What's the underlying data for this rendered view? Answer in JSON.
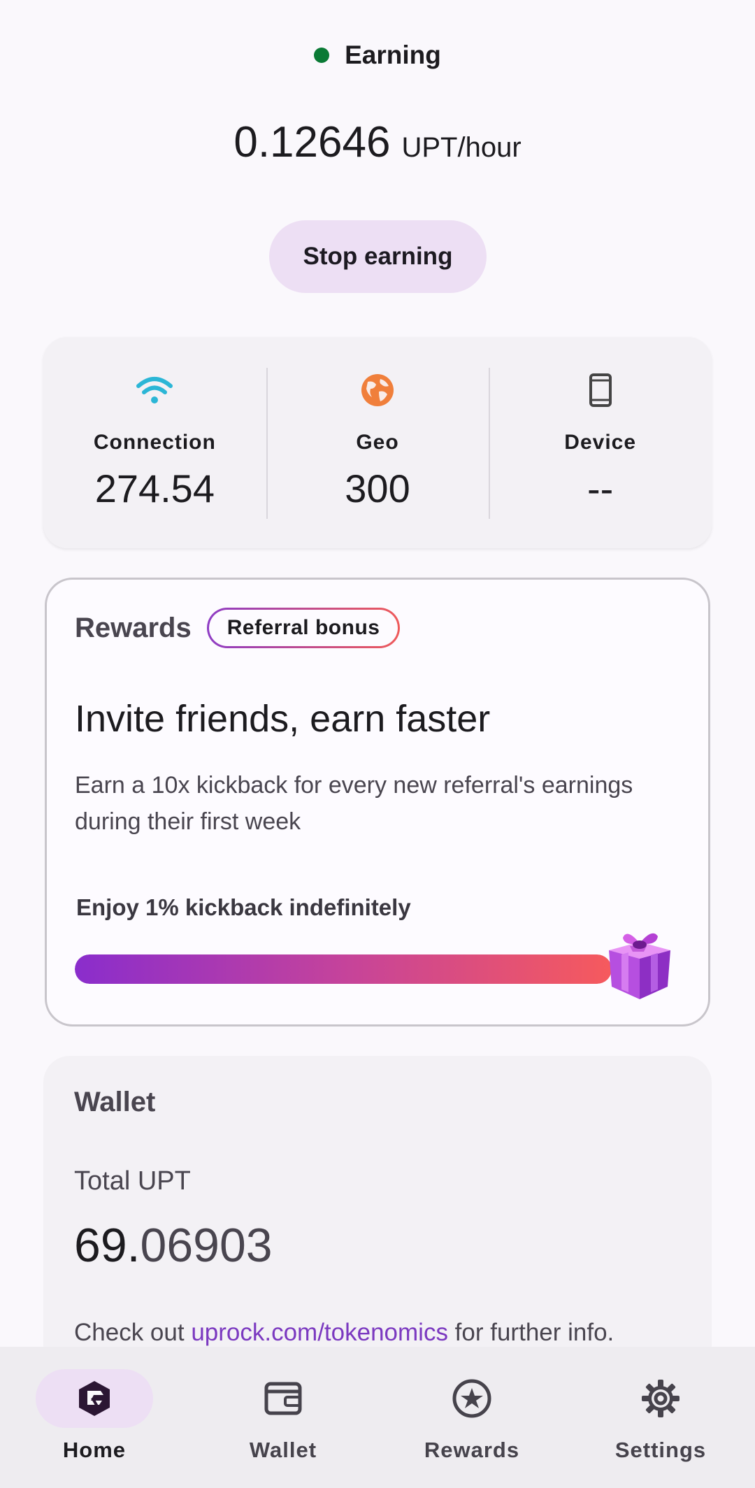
{
  "header": {
    "status": "Earning",
    "status_color": "#0a7a35",
    "rate_value": "0.12646",
    "rate_unit": "UPT/hour",
    "stop_label": "Stop earning"
  },
  "stats": [
    {
      "label": "Connection",
      "value": "274.54",
      "icon": "wifi-icon",
      "color": "#2bb6d6"
    },
    {
      "label": "Geo",
      "value": "300",
      "icon": "globe-icon",
      "color": "#f07f3b"
    },
    {
      "label": "Device",
      "value": "--",
      "icon": "phone-icon",
      "color": "#444"
    }
  ],
  "rewards": {
    "title": "Rewards",
    "badge": "Referral bonus",
    "headline": "Invite friends, earn faster",
    "description": "Earn a 10x kickback for every new referral's earnings during their first week",
    "kickback_label": "Enjoy 1% kickback indefinitely",
    "progress": 1.0
  },
  "wallet": {
    "title": "Wallet",
    "total_label": "Total UPT",
    "total_int": "69.",
    "total_dec": "06903",
    "info_prefix": "Check out ",
    "info_link": "uprock.com/tokenomics",
    "info_suffix": " for further info."
  },
  "nav": [
    {
      "label": "Home",
      "icon": "uprock-logo-icon",
      "active": true
    },
    {
      "label": "Wallet",
      "icon": "wallet-icon",
      "active": false
    },
    {
      "label": "Rewards",
      "icon": "star-badge-icon",
      "active": false
    },
    {
      "label": "Settings",
      "icon": "gear-icon",
      "active": false
    }
  ]
}
